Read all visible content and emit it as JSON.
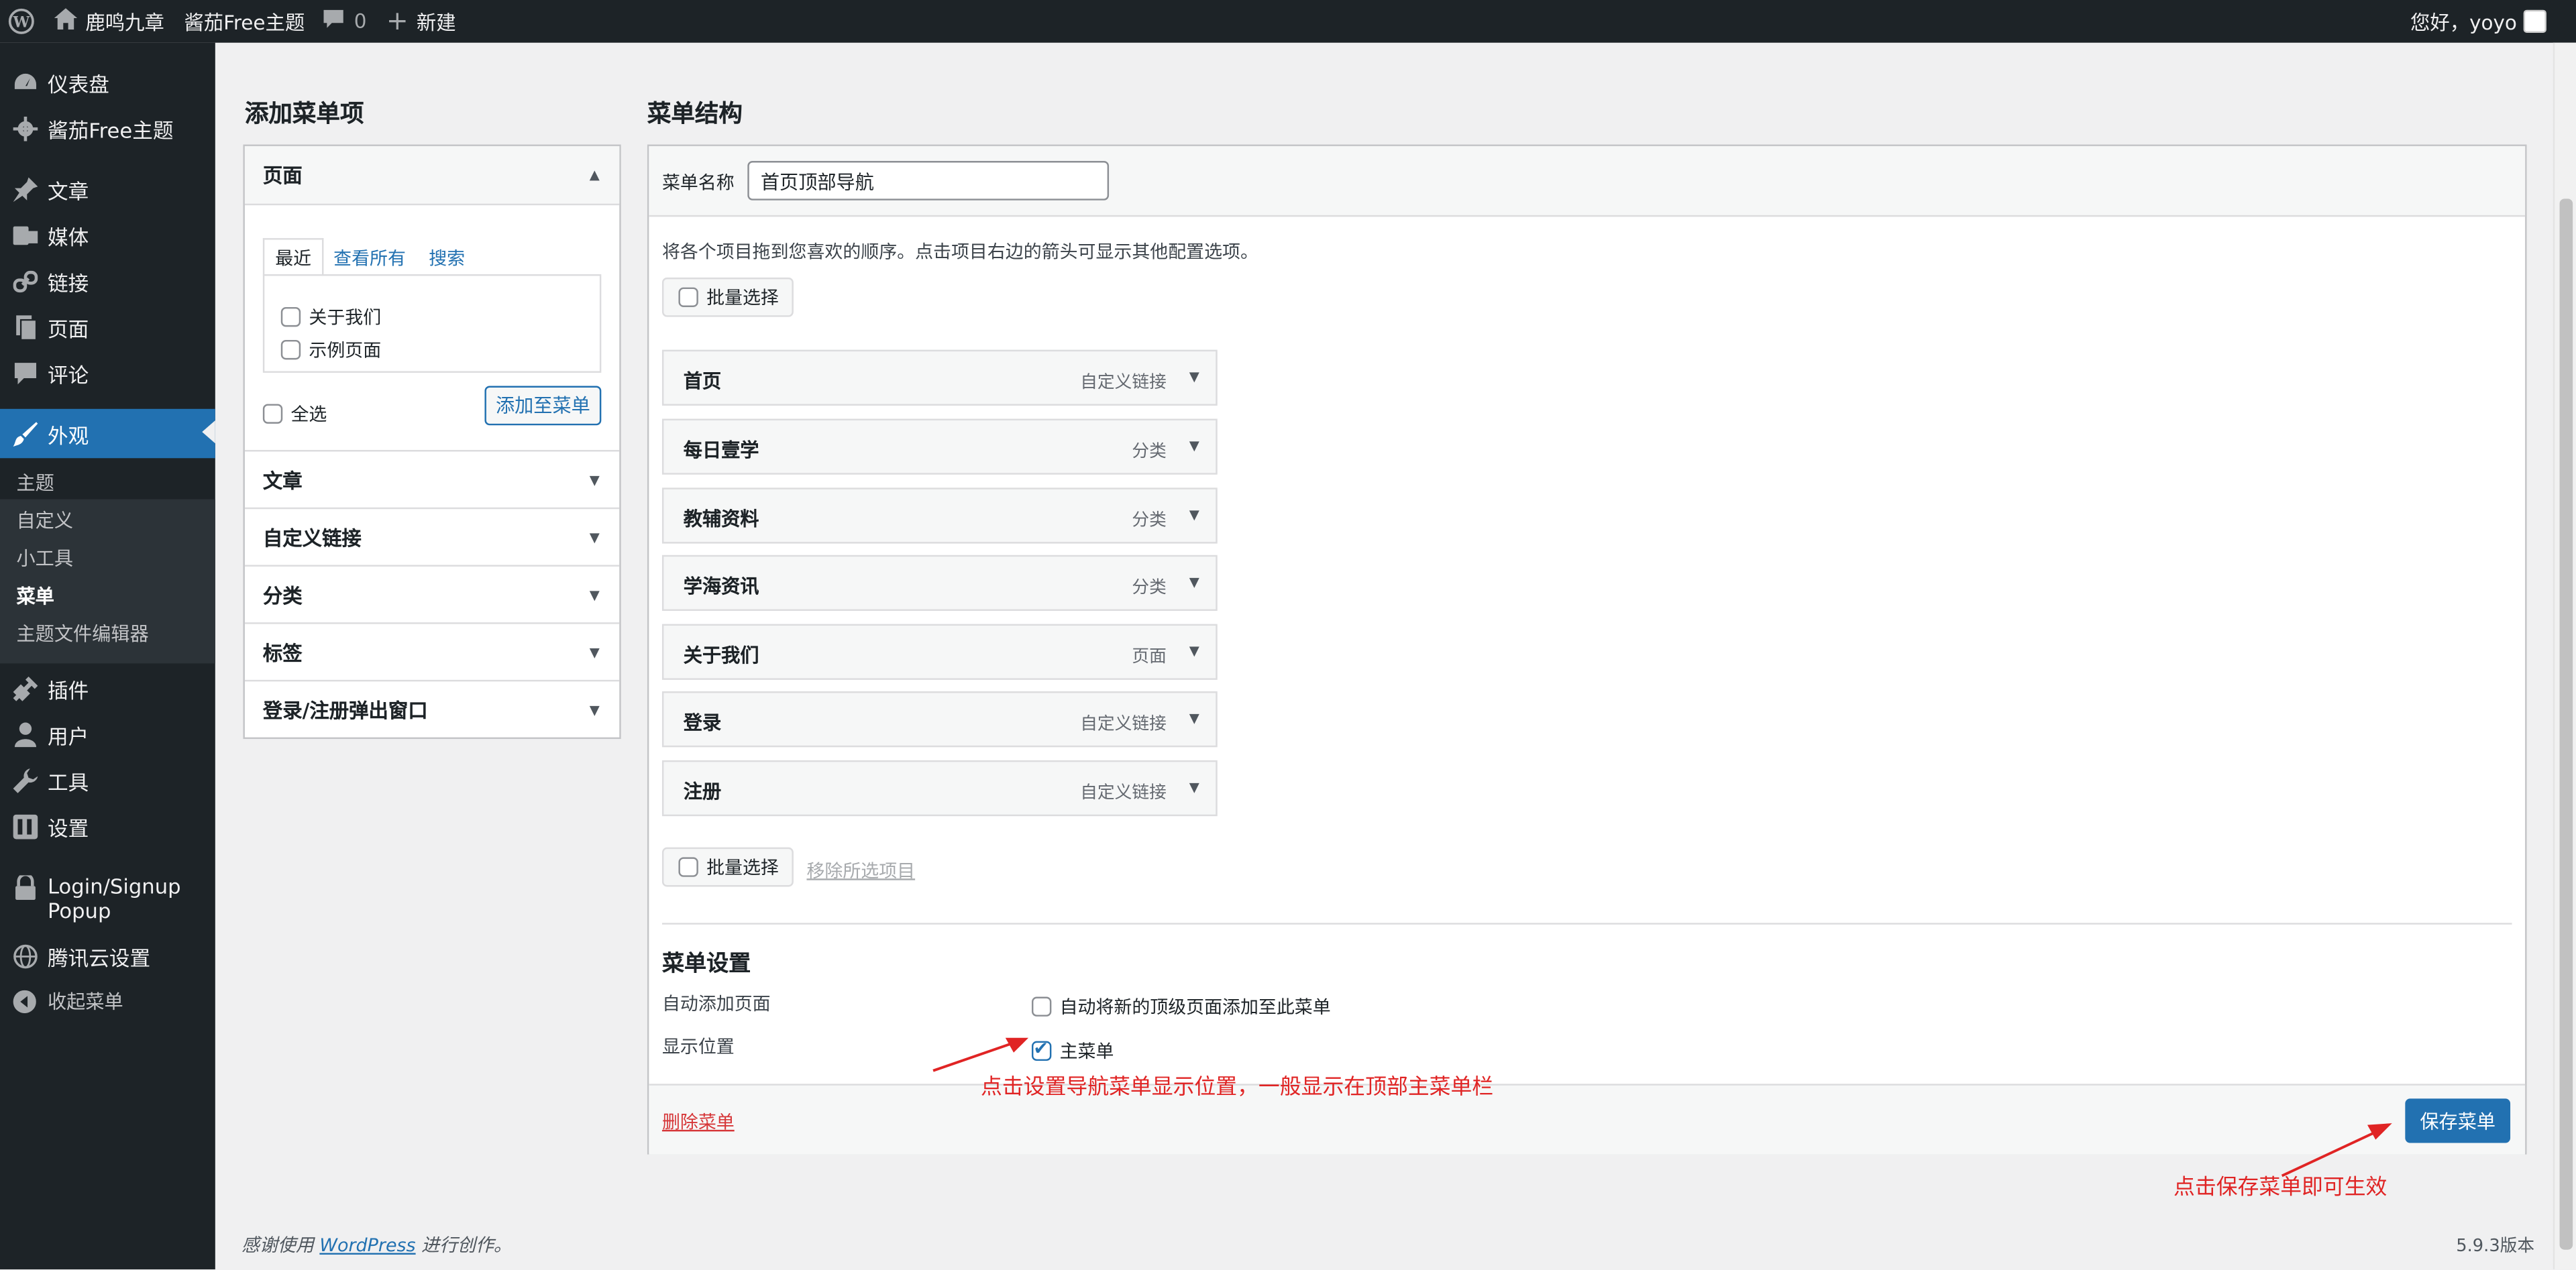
{
  "admin_bar": {
    "site_name": "鹿鸣九章",
    "theme_link": "酱茄Free主题",
    "comments_count": "0",
    "new_label": "新建",
    "greeting": "您好，yoyo"
  },
  "sidebar": {
    "items": [
      {
        "label": "仪表盘",
        "icon": "dashboard-icon"
      },
      {
        "label": "酱茄Free主题",
        "icon": "gear-icon"
      },
      {
        "label": "文章",
        "icon": "pin-icon"
      },
      {
        "label": "媒体",
        "icon": "media-icon"
      },
      {
        "label": "链接",
        "icon": "link-icon"
      },
      {
        "label": "页面",
        "icon": "page-icon"
      },
      {
        "label": "评论",
        "icon": "comment-icon"
      },
      {
        "label": "外观",
        "icon": "brush-icon"
      },
      {
        "label": "插件",
        "icon": "plugin-icon"
      },
      {
        "label": "用户",
        "icon": "user-icon"
      },
      {
        "label": "工具",
        "icon": "wrench-icon"
      },
      {
        "label": "设置",
        "icon": "settings-icon"
      },
      {
        "label": "Login/Signup Popup",
        "icon": "lock-icon"
      },
      {
        "label": "腾讯云设置",
        "icon": "globe-icon"
      },
      {
        "label": "收起菜单",
        "icon": "collapse-icon"
      }
    ],
    "submenu": [
      "主题",
      "自定义",
      "小工具",
      "菜单",
      "主题文件编辑器"
    ]
  },
  "add_items": {
    "title": "添加菜单项",
    "pages_section": "页面",
    "tabs": [
      "最近",
      "查看所有",
      "搜索"
    ],
    "pages": [
      "关于我们",
      "示例页面"
    ],
    "select_all": "全选",
    "add_button": "添加至菜单",
    "sections": [
      "文章",
      "自定义链接",
      "分类",
      "标签",
      "登录/注册弹出窗口"
    ]
  },
  "structure": {
    "title": "菜单结构",
    "name_label": "菜单名称",
    "name_value": "首页顶部导航",
    "instructions": "将各个项目拖到您喜欢的顺序。点击项目右边的箭头可显示其他配置选项。",
    "bulk_select": "批量选择",
    "remove_selected": "移除所选项目",
    "items": [
      {
        "title": "首页",
        "type": "自定义链接"
      },
      {
        "title": "每日壹学",
        "type": "分类"
      },
      {
        "title": "教辅资料",
        "type": "分类"
      },
      {
        "title": "学海资讯",
        "type": "分类"
      },
      {
        "title": "关于我们",
        "type": "页面"
      },
      {
        "title": "登录",
        "type": "自定义链接"
      },
      {
        "title": "注册",
        "type": "自定义链接"
      }
    ],
    "settings_title": "菜单设置",
    "auto_add_label": "自动添加页面",
    "auto_add_option": "自动将新的顶级页面添加至此菜单",
    "display_label": "显示位置",
    "display_option": "主菜单",
    "delete_menu": "删除菜单",
    "save_button": "保存菜单"
  },
  "annotations": {
    "location_note": "点击设置导航菜单显示位置，一般显示在顶部主菜单栏",
    "save_note": "点击保存菜单即可生效"
  },
  "footer": {
    "thanks_prefix": "感谢使用",
    "wordpress": "WordPress",
    "thanks_suffix": "进行创作。",
    "version": "5.9.3版本"
  },
  "colors": {
    "accent": "#2271b1",
    "sidebar_bg": "#1d2327",
    "annotation": "#e02424"
  }
}
